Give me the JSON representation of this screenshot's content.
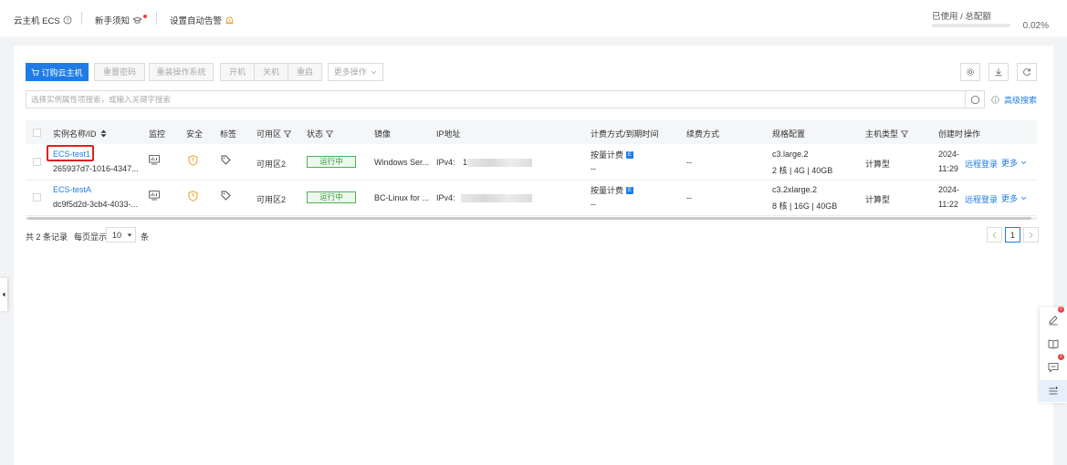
{
  "topbar": {
    "title": "云主机 ECS",
    "guide": "新手须知",
    "alarm": "设置自动告警",
    "usage_label": "已使用 / 总配额",
    "usage_pct": "0.02%"
  },
  "toolbar": {
    "order": "订购云主机",
    "reset_pwd": "重置密码",
    "reinstall": "重装操作系统",
    "start": "开机",
    "stop": "关机",
    "restart": "重启",
    "more_ops": "更多操作"
  },
  "search": {
    "placeholder": "选择实例属性项搜索，或输入关键字搜索",
    "advanced": "高级搜索"
  },
  "table": {
    "headers": {
      "name": "实例名称/ID",
      "monitor": "监控",
      "security": "安全",
      "tags": "标签",
      "zone": "可用区",
      "status": "状态",
      "image": "镜像",
      "ip": "IP地址",
      "billing": "计费方式/到期时间",
      "renew": "续费方式",
      "spec": "规格配置",
      "host_type": "主机类型",
      "created": "创建时",
      "actions": "操作"
    },
    "rows": [
      {
        "name": "ECS-test1",
        "id": "265937d7-1016-4347...",
        "zone": "可用区2",
        "status": "运行中",
        "image": "Windows Ser...",
        "ip_prefix": "IPv4:",
        "ip_visible": "1!",
        "billing": "按量计费",
        "billing_badge": "E",
        "expire": "--",
        "renew": "--",
        "spec": "c3.large.2",
        "spec_detail": "2 核 | 4G | 40GB",
        "host_type": "计算型",
        "created_date": "2024-",
        "created_time": "11:29",
        "remote": "远程登录",
        "more": "更多"
      },
      {
        "name": "ECS-testA",
        "id": "dc9f5d2d-3cb4-4033-...",
        "zone": "可用区2",
        "status": "运行中",
        "image": "BC-Linux for ...",
        "ip_prefix": "IPv4:",
        "ip_visible": "",
        "billing": "按量计费",
        "billing_badge": "E",
        "expire": "--",
        "renew": "--",
        "spec": "c3.2xlarge.2",
        "spec_detail": "8 核 | 16G | 40GB",
        "host_type": "计算型",
        "created_date": "2024-",
        "created_time": "11:22",
        "remote": "远程登录",
        "more": "更多"
      }
    ]
  },
  "footer": {
    "total": "共 2 条记录",
    "per_page_label": "每页显示",
    "per_page": "10",
    "unit": "条",
    "page": "1"
  },
  "float_panel": {
    "badge": "2"
  },
  "colors": {
    "primary": "#1f7ce6",
    "success": "#3a9a3e",
    "warning": "#f0a020",
    "danger": "#e84242"
  }
}
